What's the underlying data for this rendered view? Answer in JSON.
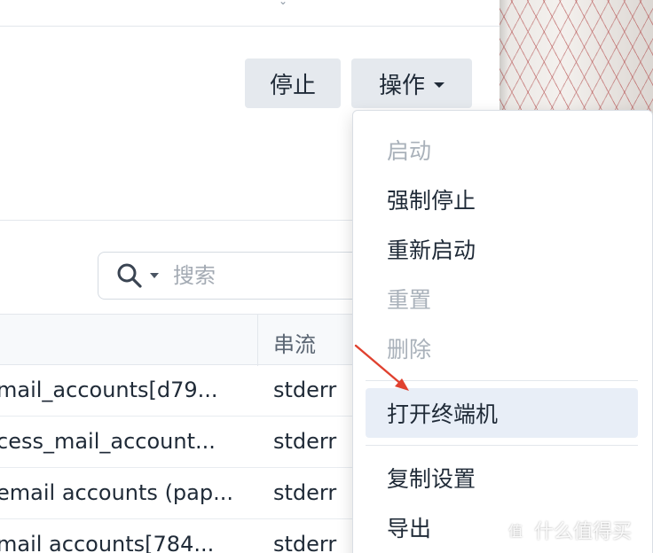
{
  "toolbar": {
    "stop_label": "停止",
    "action_label": "操作"
  },
  "search": {
    "placeholder": "搜索"
  },
  "table": {
    "columns": [
      "",
      "串流"
    ],
    "rows": [
      {
        "message": "mail_accounts[d79...",
        "stream": "stderr"
      },
      {
        "message": "cess_mail_account...",
        "stream": "stderr"
      },
      {
        "message": "email accounts (pap...",
        "stream": "stderr"
      },
      {
        "message": "mail accounts[784...",
        "stream": "stderr"
      }
    ]
  },
  "menu": {
    "items": [
      {
        "label": "启动",
        "disabled": true
      },
      {
        "label": "强制停止",
        "disabled": false
      },
      {
        "label": "重新启动",
        "disabled": false
      },
      {
        "label": "重置",
        "disabled": true
      },
      {
        "label": "删除",
        "disabled": true
      },
      {
        "label": "打开终端机",
        "disabled": false,
        "highlighted": true
      },
      {
        "label": "复制设置",
        "disabled": false
      },
      {
        "label": "导出",
        "disabled": false
      }
    ]
  },
  "watermark": {
    "logo_char": "值",
    "text": "什么值得买"
  },
  "colors": {
    "button_bg": "#e5e9ee",
    "menu_highlight": "#e8eef7",
    "disabled_text": "#a9b1ba",
    "arrow": "#e0412f"
  },
  "icons": [
    "search-icon",
    "chevron-down-icon",
    "annotation-arrow-icon"
  ]
}
